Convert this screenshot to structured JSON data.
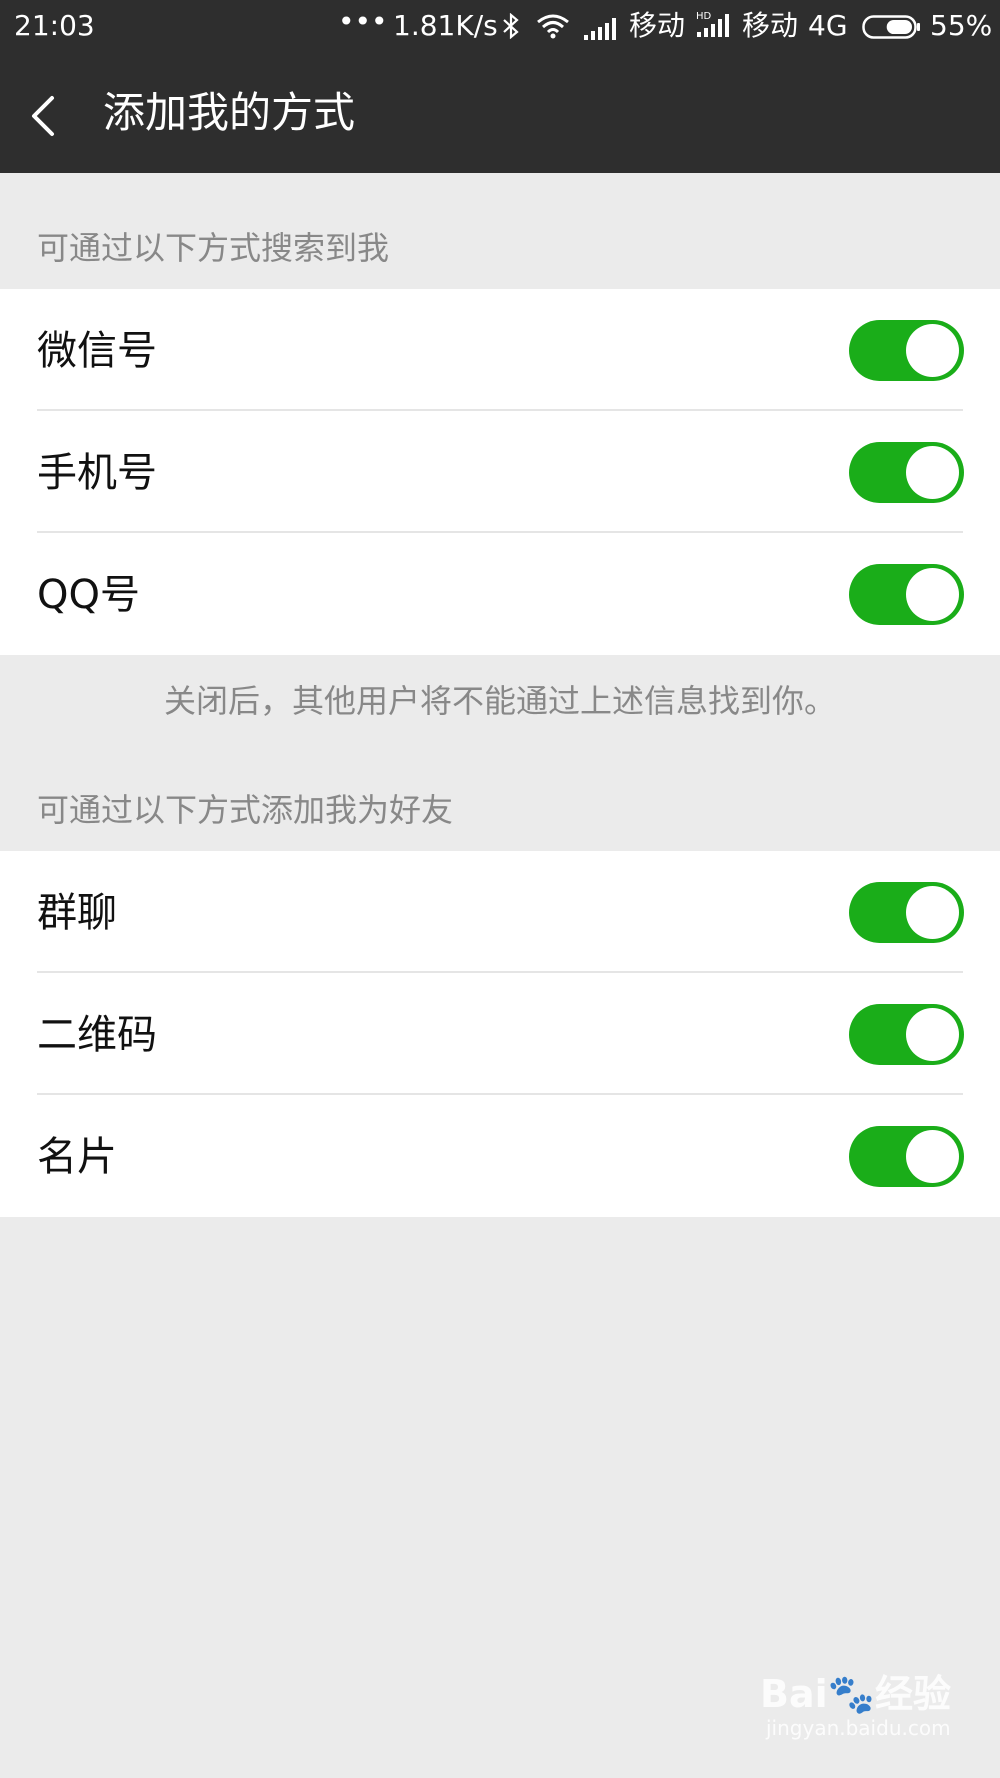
{
  "status_bar": {
    "time": "21:03",
    "more": "•••",
    "net_speed": "1.81K/s",
    "carrier1": "移动",
    "carrier2": "移动",
    "network": "4G",
    "battery": "55%",
    "battery_level": 0.55,
    "icons": [
      "bluetooth-icon",
      "wifi-icon",
      "signal-icon",
      "hd-signal-icon",
      "battery-icon"
    ]
  },
  "nav": {
    "title": "添加我的方式",
    "back_icon": "chevron-left-icon"
  },
  "sections": [
    {
      "header": "可通过以下方式搜索到我",
      "items": [
        {
          "label": "微信号",
          "enabled": true
        },
        {
          "label": "手机号",
          "enabled": true
        },
        {
          "label": "QQ号",
          "enabled": true
        }
      ],
      "footer": "关闭后，其他用户将不能通过上述信息找到你。"
    },
    {
      "header": "可通过以下方式添加我为好友",
      "items": [
        {
          "label": "群聊",
          "enabled": true
        },
        {
          "label": "二维码",
          "enabled": true
        },
        {
          "label": "名片",
          "enabled": true
        }
      ]
    }
  ],
  "colors": {
    "header_bg": "#2e2e2e",
    "page_bg": "#ebebeb",
    "toggle_on": "#1aad19",
    "muted_text": "#888888"
  },
  "watermark": {
    "main": "Bai🐾经验",
    "sub": "jingyan.baidu.com"
  }
}
